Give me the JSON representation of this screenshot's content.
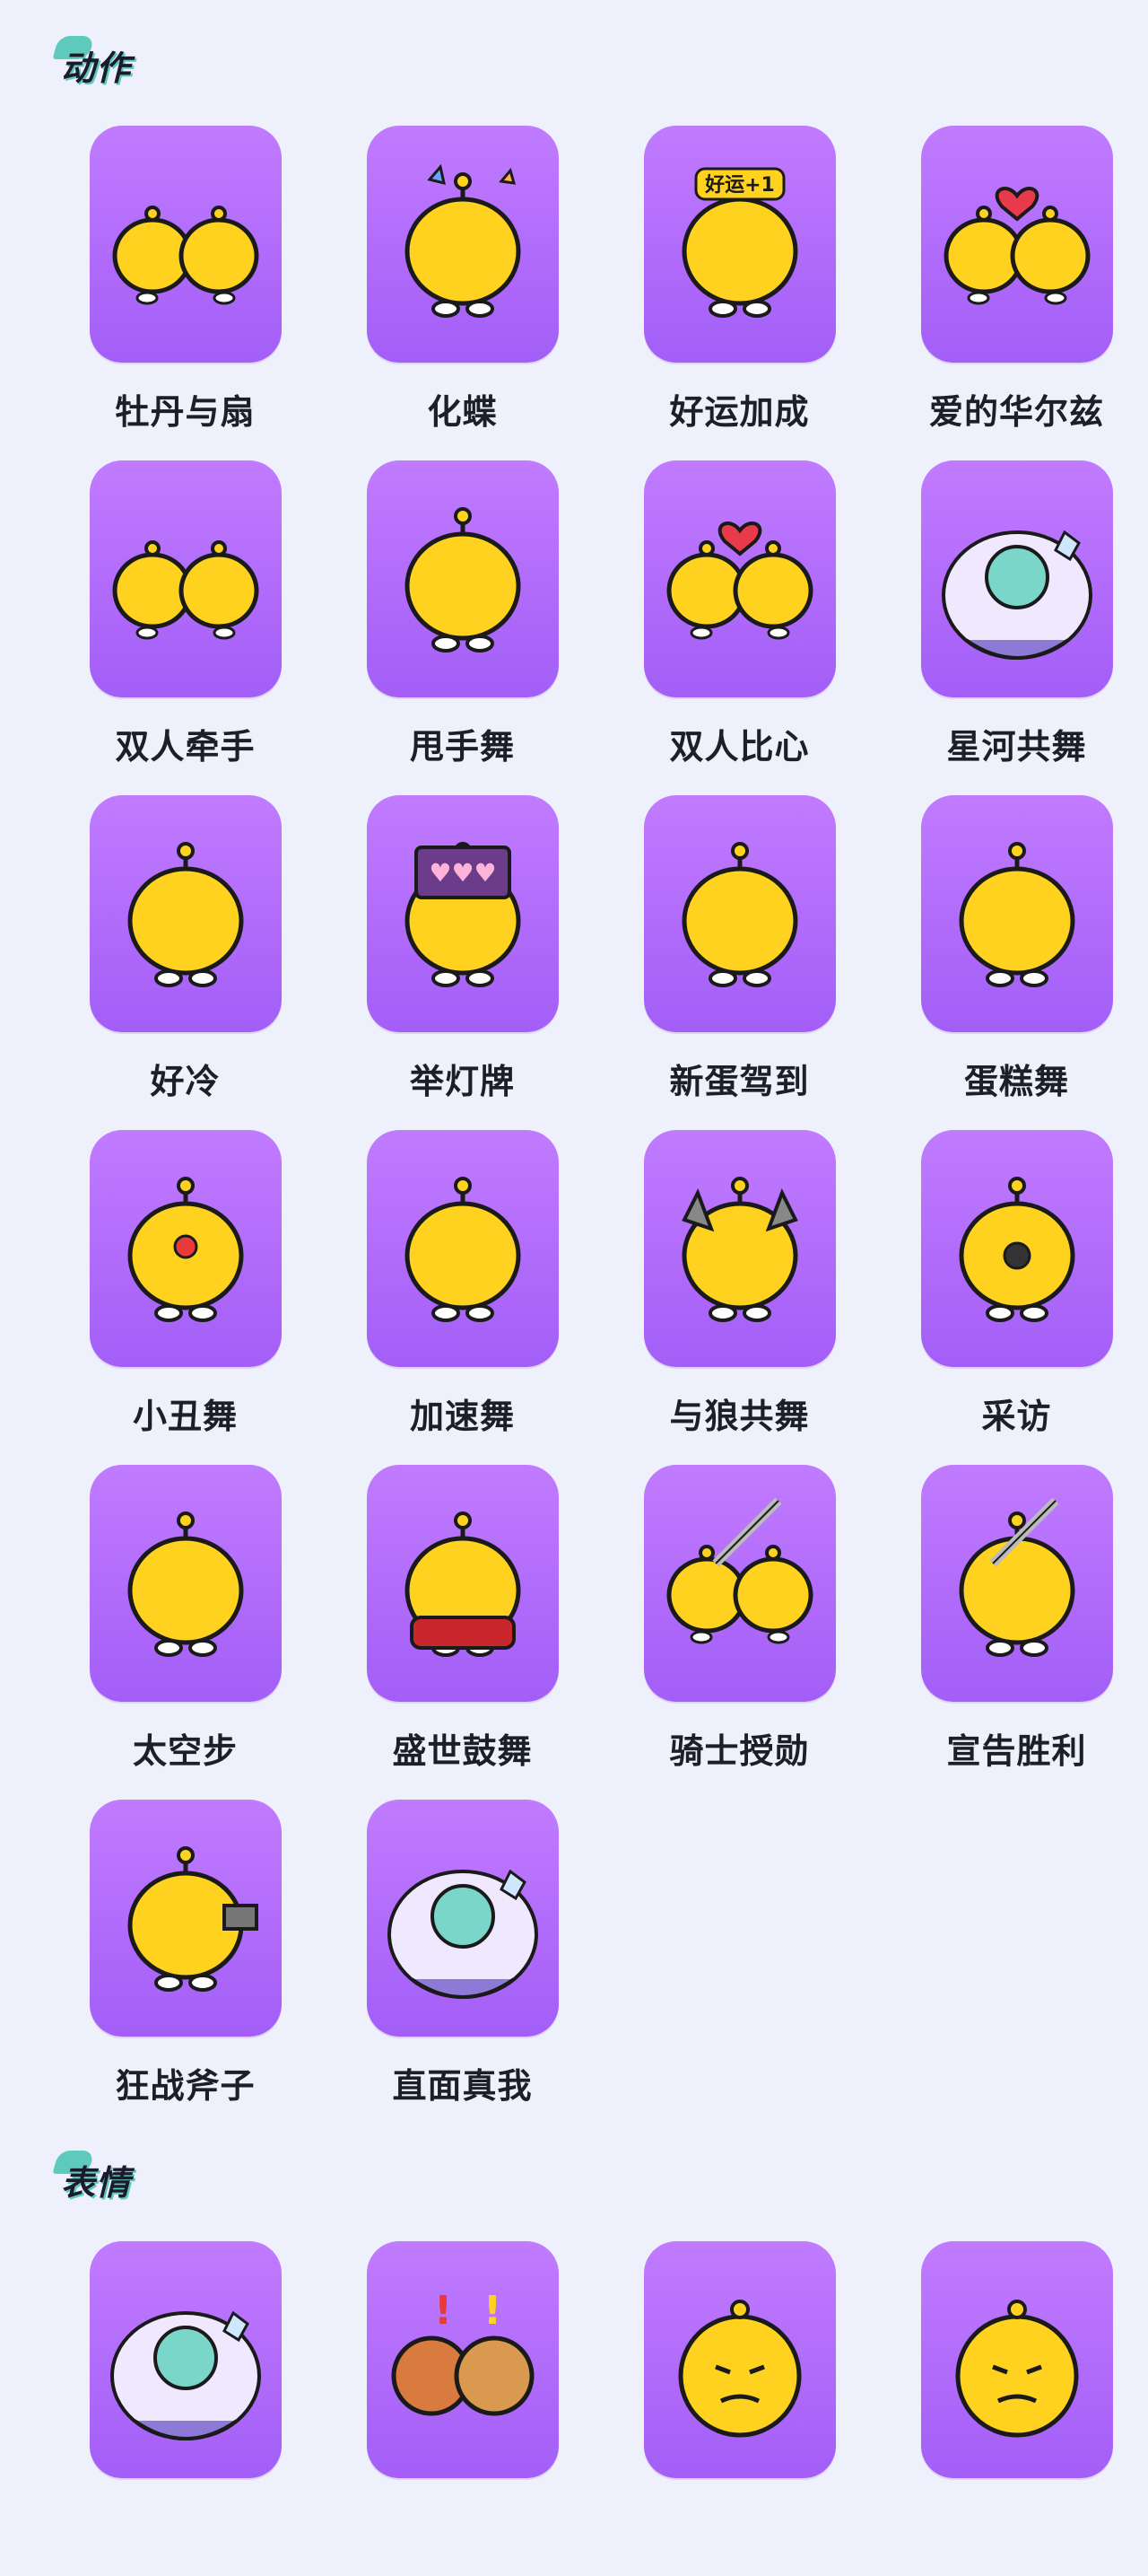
{
  "sections": [
    {
      "title": "动作",
      "items": [
        {
          "label": "牡丹与扇",
          "icon": "chick-fan-icon"
        },
        {
          "label": "化蝶",
          "icon": "chick-butterfly-icon"
        },
        {
          "label": "好运加成",
          "icon": "chick-luck-icon",
          "badge": "好运+1"
        },
        {
          "label": "爱的华尔兹",
          "icon": "chick-heart-waltz-icon"
        },
        {
          "label": "双人牵手",
          "icon": "chick-hand-hold-icon"
        },
        {
          "label": "甩手舞",
          "icon": "chick-arm-swing-icon"
        },
        {
          "label": "双人比心",
          "icon": "chick-double-heart-icon"
        },
        {
          "label": "星河共舞",
          "icon": "chick-galaxy-dance-icon"
        },
        {
          "label": "好冷",
          "icon": "chick-cold-icon"
        },
        {
          "label": "举灯牌",
          "icon": "chick-light-sign-icon"
        },
        {
          "label": "新蛋驾到",
          "icon": "chick-new-egg-icon"
        },
        {
          "label": "蛋糕舞",
          "icon": "chick-cake-dance-icon"
        },
        {
          "label": "小丑舞",
          "icon": "chick-clown-icon"
        },
        {
          "label": "加速舞",
          "icon": "chick-speed-icon"
        },
        {
          "label": "与狼共舞",
          "icon": "chick-wolf-icon"
        },
        {
          "label": "采访",
          "icon": "chick-microphone-icon"
        },
        {
          "label": "太空步",
          "icon": "chick-moonwalk-icon"
        },
        {
          "label": "盛世鼓舞",
          "icon": "chick-drum-icon"
        },
        {
          "label": "骑士授勋",
          "icon": "chick-knight-icon"
        },
        {
          "label": "宣告胜利",
          "icon": "chick-victory-sword-icon"
        },
        {
          "label": "狂战斧子",
          "icon": "chick-axe-icon"
        },
        {
          "label": "直面真我",
          "icon": "hero-crystal-icon"
        }
      ]
    },
    {
      "title": "表情",
      "items": [
        {
          "label": "",
          "icon": "hero-peacock-icon"
        },
        {
          "label": "",
          "icon": "bears-exclaim-icon"
        },
        {
          "label": "",
          "icon": "chick-smug-face-icon"
        },
        {
          "label": "",
          "icon": "chick-party-horn-icon"
        }
      ]
    }
  ],
  "colors": {
    "card_top": "#c17bff",
    "card_bottom": "#a35ef7",
    "chick": "#ffd21f",
    "background": "#eef0fb"
  }
}
